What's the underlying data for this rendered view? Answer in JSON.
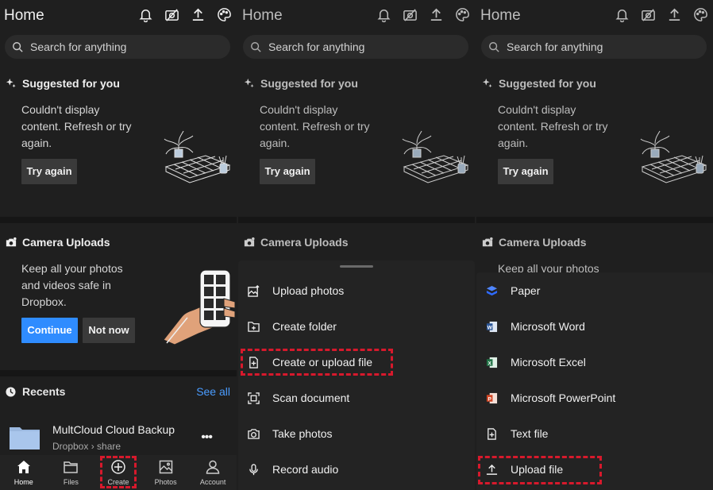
{
  "panels": [
    {
      "title": "Home",
      "search_placeholder": "Search for anything",
      "suggested": {
        "heading": "Suggested for you",
        "message": "Couldn't display content. Refresh or try again.",
        "button": "Try again"
      },
      "camera": {
        "heading": "Camera Uploads",
        "message": "Keep all your photos and videos safe in Dropbox.",
        "continue": "Continue",
        "not_now": "Not now"
      },
      "recents": {
        "heading": "Recents",
        "see_all": "See all",
        "items": [
          {
            "name": "MultCloud Cloud Backup",
            "path": "Dropbox › share"
          }
        ]
      },
      "nav": [
        {
          "label": "Home",
          "icon": "home-icon"
        },
        {
          "label": "Files",
          "icon": "folder-icon"
        },
        {
          "label": "Create",
          "icon": "plus-circle-icon"
        },
        {
          "label": "Photos",
          "icon": "photo-icon"
        },
        {
          "label": "Account",
          "icon": "person-icon"
        }
      ]
    },
    {
      "title": "Home",
      "search_placeholder": "Search for anything",
      "suggested": {
        "heading": "Suggested for you",
        "message": "Couldn't display content. Refresh or try again.",
        "button": "Try again"
      },
      "camera": {
        "heading": "Camera Uploads"
      },
      "sheet": [
        {
          "label": "Upload photos",
          "icon": "upload-photo-icon"
        },
        {
          "label": "Create folder",
          "icon": "folder-plus-icon"
        },
        {
          "label": "Create or upload file",
          "icon": "file-plus-icon"
        },
        {
          "label": "Scan document",
          "icon": "scan-icon"
        },
        {
          "label": "Take photos",
          "icon": "camera-icon"
        },
        {
          "label": "Record audio",
          "icon": "microphone-icon"
        }
      ]
    },
    {
      "title": "Home",
      "search_placeholder": "Search for anything",
      "suggested": {
        "heading": "Suggested for you",
        "message": "Couldn't display content. Refresh or try again.",
        "button": "Try again"
      },
      "camera": {
        "heading": "Camera Uploads",
        "message": "Keep all your photos"
      },
      "sheet": [
        {
          "label": "Paper",
          "icon": "paper-icon"
        },
        {
          "label": "Microsoft Word",
          "icon": "word-icon"
        },
        {
          "label": "Microsoft Excel",
          "icon": "excel-icon"
        },
        {
          "label": "Microsoft PowerPoint",
          "icon": "powerpoint-icon"
        },
        {
          "label": "Text file",
          "icon": "text-file-icon"
        },
        {
          "label": "Upload file",
          "icon": "upload-icon"
        }
      ]
    }
  ],
  "top_icons": [
    "bell-icon",
    "camera-off-icon",
    "upload-icon",
    "palette-icon"
  ],
  "colors": {
    "background": "#1f1f1f",
    "accent_blue": "#2f8cff",
    "link_blue": "#4a9cff",
    "highlight_red": "#d7192c",
    "word_blue": "#2b579a",
    "excel_green": "#217346",
    "powerpoint_orange": "#d24726",
    "paper_blue": "#2f6bff"
  }
}
